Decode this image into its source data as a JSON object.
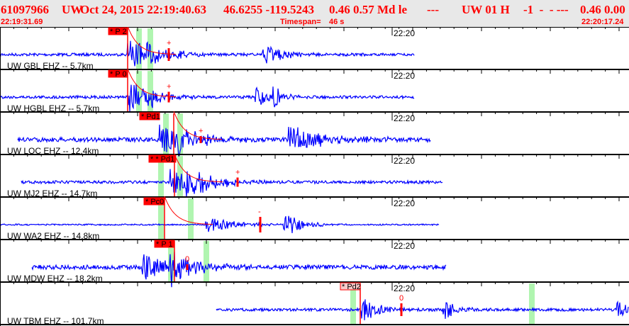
{
  "header": {
    "event_id": "61097966",
    "network": "UW",
    "datetime": "Oct 24, 2015 22:19:40.63",
    "lat_lon": "46.6255 -119.5243",
    "magnitudes": "0.46 0.57 Md le",
    "dash1": "---",
    "source": "UW 01 H",
    "flags": "-1  -  - ---",
    "values": "0.46 0.00",
    "start_time": "22:19:31.69",
    "timespan_label": "Timespan=",
    "timespan_value": "46 s",
    "end_time": "22:20:17.24"
  },
  "time_tick": "22:20",
  "channels": [
    {
      "label": "UW GBL EHZ -- 5.7km",
      "pick": "* P 2",
      "mark": "+"
    },
    {
      "label": "UW HGBL EHZ -- 5.7km",
      "pick": "* P 0",
      "mark": "+"
    },
    {
      "label": "UW LOC EHZ -- 12.4km",
      "pick": "* Pd1",
      "mark": "+"
    },
    {
      "label": "UW MJ2 EHZ -- 14.7km",
      "pick": "* * Pd1",
      "mark": "+"
    },
    {
      "label": "UW WA2 EHZ -- 14.8km",
      "pick": "* Pc0",
      "mark": "-"
    },
    {
      "label": "UW MDW EHZ -- 18.2km",
      "pick": "* P 1",
      "mark": "0"
    },
    {
      "label": "UW TBM EHZ -- 101.7km",
      "pick": "* Pd2",
      "mark": "0"
    }
  ],
  "colors": {
    "trace": "#0000ff",
    "pick": "#ff0000",
    "band": "#b0f5b0",
    "header_bg": "#e8e8e8"
  }
}
